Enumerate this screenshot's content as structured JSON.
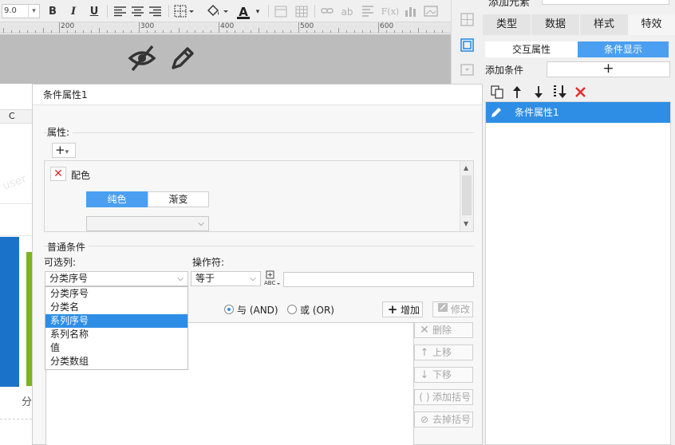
{
  "toolbar": {
    "font_size": "9.0",
    "bold": "B",
    "italic": "I",
    "underline": "U",
    "text_color_glyph": "A",
    "ab_glyph": "ab",
    "fx_glyph": "F(x)"
  },
  "ruler": {
    "labels": [
      "200",
      "300",
      "400",
      "500",
      "600"
    ]
  },
  "background": {
    "column_letter": "C",
    "watermark": "user",
    "axis_fragment": "分"
  },
  "dialog": {
    "title": "条件属性1",
    "property_group_label": "属性:",
    "add_button": "+",
    "property_name": "配色",
    "color_mode_tabs": [
      "纯色",
      "渐变"
    ],
    "condition_group_label": "普通条件",
    "column_label": "可选列:",
    "operator_label": "操作符:",
    "column_selected": "分类序号",
    "column_options": [
      "分类序号",
      "分类名",
      "系列序号",
      "系列名称",
      "值",
      "分类数组"
    ],
    "column_highlighted_index": 2,
    "operator_selected": "等于",
    "operator_value": "",
    "and_label": "与 (AND)",
    "or_label": "或 (OR)",
    "add_condition": "增加",
    "modify": "修改",
    "delete": "删除",
    "move_up": "上移",
    "move_down": "下移",
    "add_bracket": "添加括号",
    "remove_bracket": "去掉括号"
  },
  "right_panel": {
    "top_fragment": "添加元素",
    "tabs": [
      "类型",
      "数据",
      "样式",
      "特效"
    ],
    "active_tab_index": 3,
    "sub_tabs": [
      "交互属性",
      "条件显示"
    ],
    "active_sub_tab_index": 1,
    "add_condition_label": "添加条件",
    "add_condition_button": "+",
    "conditions": [
      "条件属性1"
    ]
  },
  "colors": {
    "accent": "#2e8ee6",
    "danger": "#e32b2b",
    "chart_blue": "#1a73c8",
    "chart_green": "#7ab51d"
  }
}
